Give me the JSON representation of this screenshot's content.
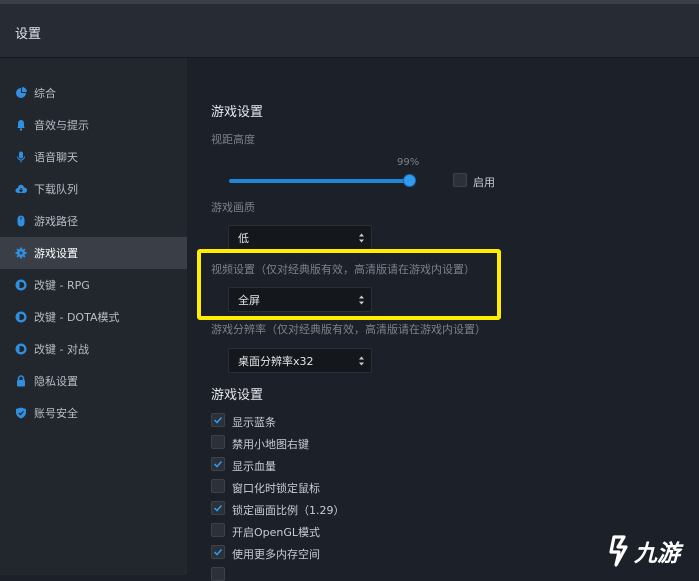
{
  "window": {
    "title": "设置"
  },
  "sidebar": {
    "items": [
      {
        "label": "综合",
        "icon": "pie-chart-icon"
      },
      {
        "label": "音效与提示",
        "icon": "bell-icon"
      },
      {
        "label": "语音聊天",
        "icon": "microphone-icon"
      },
      {
        "label": "下载队列",
        "icon": "cloud-download-icon"
      },
      {
        "label": "游戏路径",
        "icon": "mouse-icon"
      },
      {
        "label": "游戏设置",
        "icon": "gear-icon",
        "active": true
      },
      {
        "label": "改键 - RPG",
        "icon": "key-badge-icon"
      },
      {
        "label": "改键 - DOTA模式",
        "icon": "key-badge-icon"
      },
      {
        "label": "改键 - 对战",
        "icon": "key-badge-icon"
      },
      {
        "label": "隐私设置",
        "icon": "lock-icon"
      },
      {
        "label": "账号安全",
        "icon": "shield-icon"
      }
    ]
  },
  "main": {
    "section1_title": "游戏设置",
    "view_distance": {
      "label": "视距高度",
      "value_text": "99%",
      "value": 0.99
    },
    "enable_label": "启用",
    "quality": {
      "label": "游戏画质",
      "selected": "低"
    },
    "display_mode": {
      "label": "视频设置（仅对经典版有效，高清版请在游戏内设置）",
      "selected": "全屏"
    },
    "resolution": {
      "label": "游戏分辨率（仅对经典版有效，高清版请在游戏内设置）",
      "selected": "桌面分辨率x32"
    },
    "section2_title": "游戏设置",
    "options": [
      {
        "label": "显示蓝条",
        "checked": true
      },
      {
        "label": "禁用小地图右键",
        "checked": false
      },
      {
        "label": "显示血量",
        "checked": true
      },
      {
        "label": "窗口化时锁定鼠标",
        "checked": false
      },
      {
        "label": "锁定画面比例（1.29）",
        "checked": true
      },
      {
        "label": "开启OpenGL模式",
        "checked": false
      },
      {
        "label": "使用更多内存空间",
        "checked": true
      },
      {
        "label": "",
        "checked": false
      }
    ]
  },
  "watermark": {
    "text": "九游"
  },
  "colors": {
    "accent": "#1f87d6",
    "highlight": "#ffee00",
    "active_bg": "#3a3f47"
  }
}
